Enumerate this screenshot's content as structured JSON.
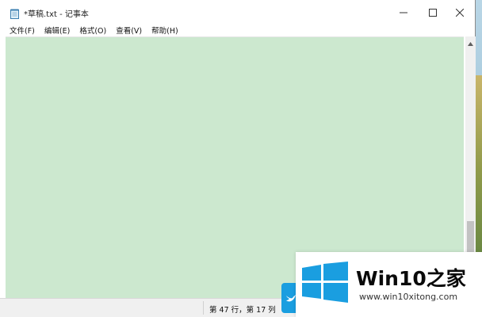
{
  "window": {
    "title": "*草稿.txt - 记事本"
  },
  "menu": {
    "items": [
      {
        "label": "文件(F)"
      },
      {
        "label": "编辑(E)"
      },
      {
        "label": "格式(O)"
      },
      {
        "label": "查看(V)"
      },
      {
        "label": "帮助(H)"
      }
    ]
  },
  "editor": {
    "content": "",
    "background_color": "#cce8cf"
  },
  "statusbar": {
    "position": "第 47 行，第 17 列"
  },
  "watermark": {
    "brand": "Win10",
    "brand_cn": "之家",
    "url": "www.win10xitong.com",
    "logo_color": "#1a9ee0"
  },
  "icons": {
    "app": "notepad-icon",
    "minimize": "minimize-icon",
    "maximize": "maximize-icon",
    "close": "close-icon"
  }
}
